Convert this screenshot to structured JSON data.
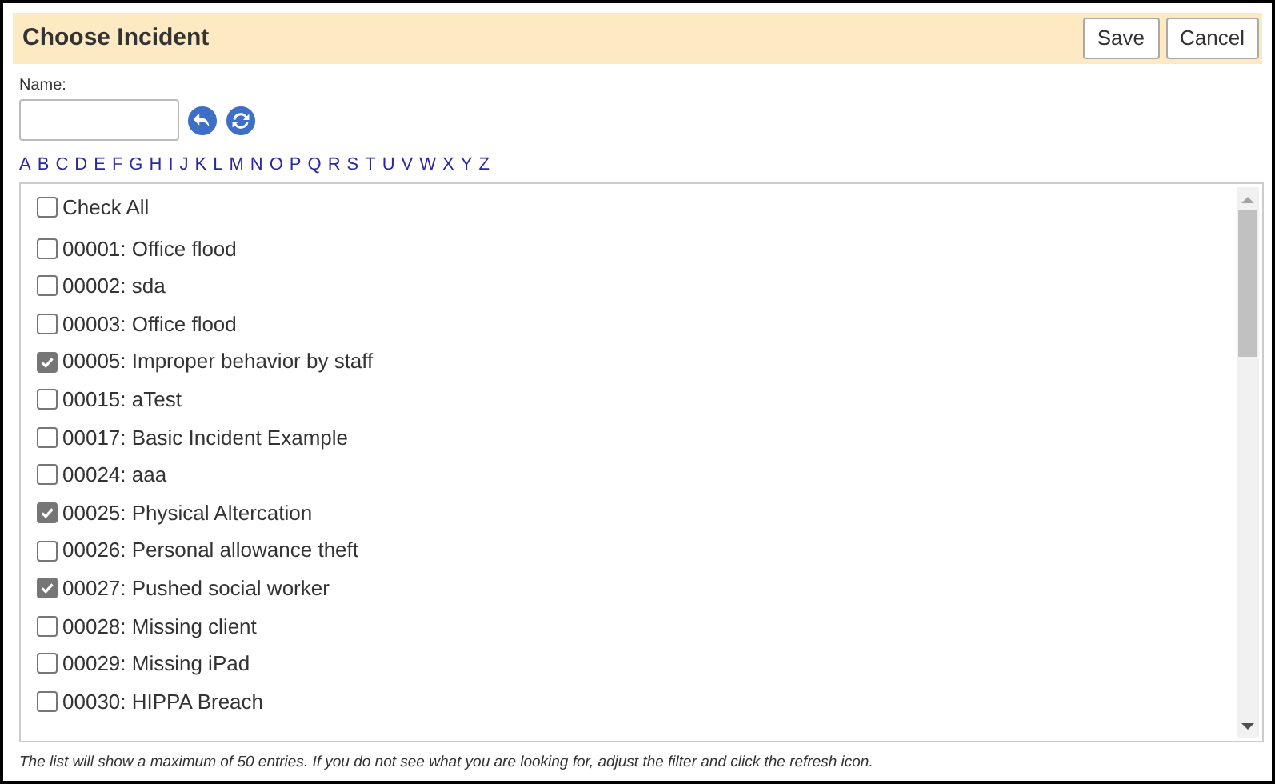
{
  "title": "Choose Incident",
  "buttons": [
    "Save",
    "Cancel"
  ],
  "name_field": {
    "label": "Name:"
  },
  "alphabet": [
    "A",
    "B",
    "C",
    "D",
    "E",
    "F",
    "G",
    "H",
    "I",
    "J",
    "K",
    "L",
    "M",
    "N",
    "O",
    "P",
    "Q",
    "R",
    "S",
    "T",
    "U",
    "V",
    "W",
    "X",
    "Y",
    "Z"
  ],
  "check_all": {
    "label": "Check All",
    "checked": false
  },
  "incidents": [
    {
      "label": "00001: Office flood",
      "checked": false
    },
    {
      "label": "00002: sda",
      "checked": false
    },
    {
      "label": "00003: Office flood",
      "checked": false
    },
    {
      "label": "00005: Improper behavior by staff",
      "checked": true
    },
    {
      "label": "00015: aTest",
      "checked": false
    },
    {
      "label": "00017: Basic Incident Example",
      "checked": false
    },
    {
      "label": "00024: aaa",
      "checked": false
    },
    {
      "label": "00025: Physical Altercation",
      "checked": true
    },
    {
      "label": "00026: Personal allowance theft",
      "checked": false
    },
    {
      "label": "00027: Pushed social worker",
      "checked": true
    },
    {
      "label": "00028: Missing client",
      "checked": false
    },
    {
      "label": "00029: Missing iPad",
      "checked": false
    },
    {
      "label": "00030: HIPPA Breach",
      "checked": false
    }
  ],
  "footer": "The list will show a maximum of 50 entries. If you do not see what you are looking for, adjust the filter and click the refresh icon."
}
